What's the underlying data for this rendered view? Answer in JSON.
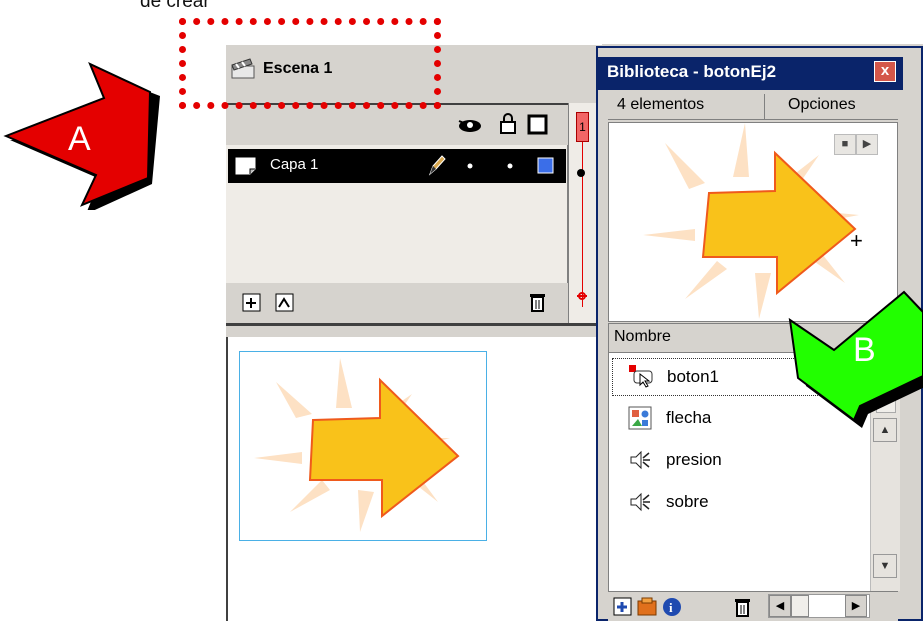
{
  "caption_top": "de crear",
  "annotations": {
    "a_label": "A",
    "b_label": "B",
    "a_color": "#e40000",
    "b_color": "#22ff00",
    "highlight_color": "#e40000"
  },
  "scene": {
    "label": "Escena 1",
    "icon": "clapperboard-icon"
  },
  "timeline": {
    "frame_number": "1",
    "header_icons": [
      "eye-icon",
      "lock-icon",
      "outline-square-icon"
    ],
    "layers": [
      {
        "name": "Capa 1",
        "icon": "layer-icon",
        "extras": [
          "pencil-icon",
          "dot",
          "dot",
          "color-square"
        ]
      }
    ],
    "footer_icons": [
      "insert-layer-icon",
      "add-guide-layer-icon",
      "trash-icon"
    ]
  },
  "library": {
    "title": "Biblioteca - botonEj2",
    "close": "x",
    "count": "4 elementos",
    "options": "Opciones",
    "preview_cursor": "+",
    "column_header": "Nombre",
    "items": [
      {
        "label": "boton1",
        "icon": "button-symbol-icon",
        "selected": true
      },
      {
        "label": "flecha",
        "icon": "graphic-symbol-icon",
        "selected": false
      },
      {
        "label": "presion",
        "icon": "sound-icon",
        "selected": false
      },
      {
        "label": "sobre",
        "icon": "sound-icon",
        "selected": false
      }
    ],
    "bottom_icons": [
      "new-symbol-icon",
      "new-folder-icon",
      "properties-icon",
      "trash-icon"
    ],
    "accent": "#0a246a"
  },
  "colors": {
    "arrow_fill": "#f9c21a",
    "arrow_stroke": "#ef5a1c",
    "rays": "#fde1c4",
    "stage_border": "#4ab0e6"
  }
}
